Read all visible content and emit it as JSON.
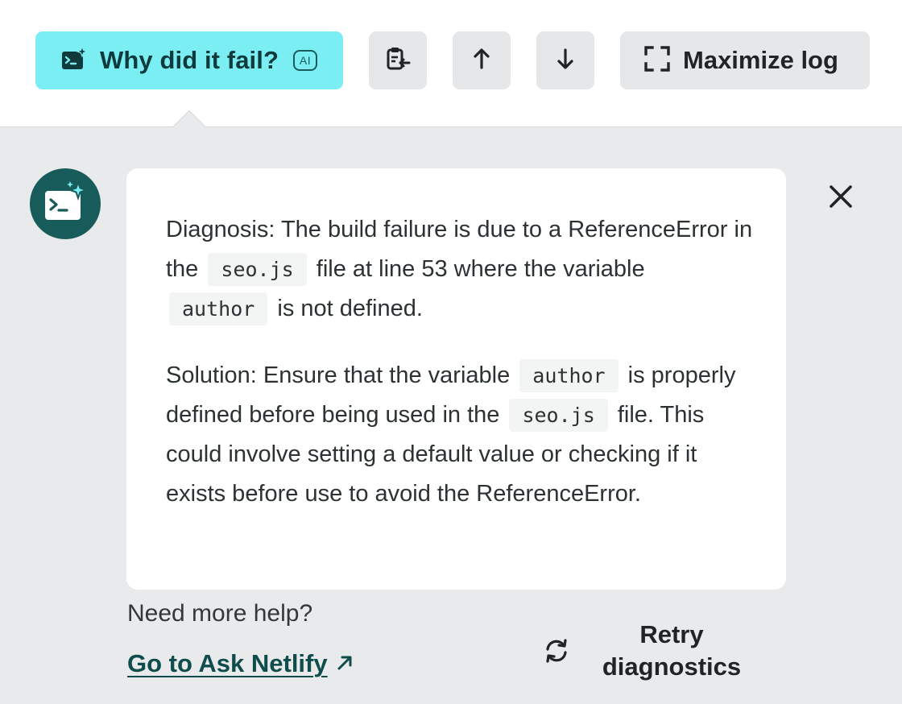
{
  "toolbar": {
    "why_label": "Why did it fail?",
    "ai_badge": "AI",
    "maximize_label": "Maximize log"
  },
  "diagnosis": {
    "lead": "Diagnosis:",
    "text_1": "The build failure is due to a ReferenceError in the",
    "code_1": "seo.js",
    "text_2": "file at line 53 where the variable",
    "code_2": "author",
    "text_3": "is not defined."
  },
  "solution": {
    "lead": "Solution:",
    "text_1": "Ensure that the variable",
    "code_1": "author",
    "text_2": "is properly defined before being used in the",
    "code_2": "seo.js",
    "text_3": "file. This could involve setting a default value or checking if it exists before use to avoid the ReferenceError."
  },
  "footer": {
    "help_question": "Need more help?",
    "ask_link": "Go to Ask Netlify",
    "retry_label": "Retry diagnostics"
  },
  "icons": {
    "why_button": "terminal-sparkle-icon",
    "copy_button": "clipboard-copy-icon",
    "up_button": "arrow-up-icon",
    "down_button": "arrow-down-icon",
    "maximize_button": "maximize-icon",
    "avatar": "terminal-sparkle-icon",
    "close": "close-icon",
    "ask_link": "arrow-up-right-icon",
    "retry": "refresh-icon"
  },
  "colors": {
    "accent": "#7aeef3",
    "avatar_bg": "#175c5a",
    "link": "#0f4c4c",
    "panel_bg": "#e9eaeb"
  }
}
